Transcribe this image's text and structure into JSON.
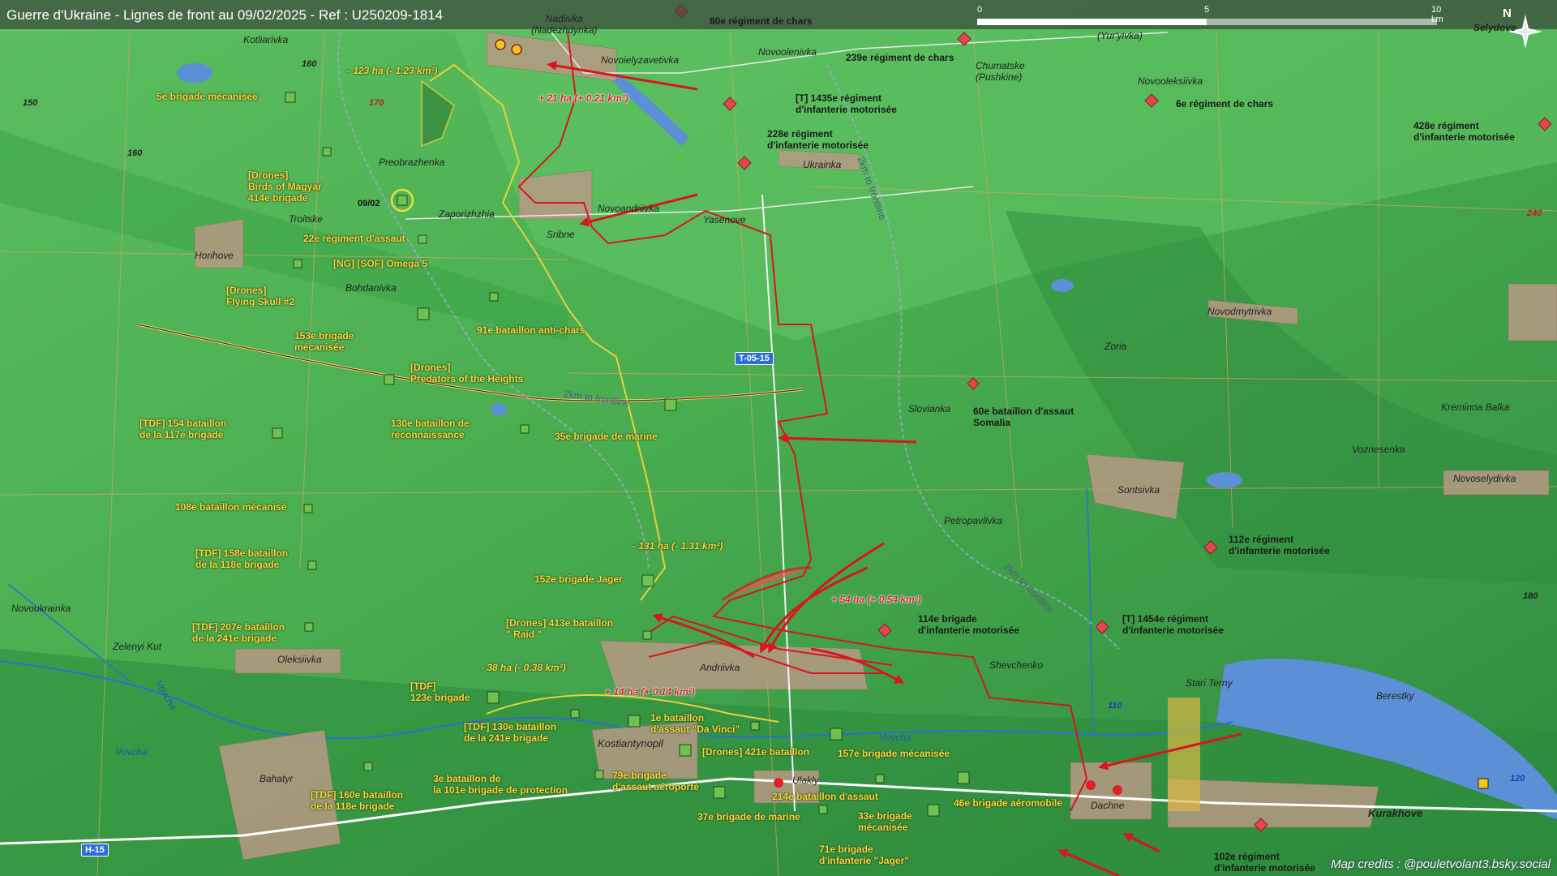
{
  "title": "Guerre d'Ukraine - Lignes de front au 09/02/2025 - Ref : U250209-1814",
  "credits": "Map credits : @pouletvolant3.bsky.social",
  "scale": {
    "ticks": [
      "0",
      "5",
      "10 km"
    ]
  },
  "north": "N",
  "colors": {
    "front": "#d8161e",
    "ua_unit": "#ffd23a",
    "ru_unit": "#e4464f",
    "water": "#5b8fd6"
  },
  "towns": {
    "nadiivka": "Nadiivka\n(Nadezhdynka)",
    "kotliarivka": "Kotliarivka",
    "novoielyzavetivka": "Novoielyzavetivka",
    "novoolenivka": "Novoolenivka",
    "chumatske": "Chumatske\n(Pushkine)",
    "yuryivka": "(Yur'yivka)",
    "selydove": "Selydove",
    "novooleksiivka": "Novooleksiivka",
    "preobrazhenka": "Preobrazhenka",
    "ukrainka": "Ukrainka",
    "troitske": "Troitske",
    "zaporizhzhia": "Zaporizhzhia",
    "novoandriivka": "Novoandriivka",
    "yasenove": "Yasenove",
    "sribne": "Sribne",
    "horihove": "Horihove",
    "bohdanivka": "Bohdanivka",
    "novodmytrivka": "Novodmytrivka",
    "zoria": "Zoria",
    "slovianka": "Slovianka",
    "kreminna_balka": "Kreminna Balka",
    "voznesenka": "Voznesenka",
    "novoselydivka": "Novoselydivka",
    "sontsivka": "Sontsivka",
    "petropavlivka": "Petropavlivka",
    "novoukrainka": "Novoukrainka",
    "zelenyi_kut": "Zelenyi Kut",
    "oleksiivka": "Oleksiivka",
    "andriivka": "Andriivka",
    "shevchenko": "Shevchenko",
    "stari_terny": "Stari Terny",
    "berestky": "Berestky",
    "kostiantynopil": "Kostiantynopil",
    "ulakly": "Ulakly",
    "bahatyr": "Bahatyr",
    "dachne": "Dachne",
    "kurakhove": "Kurakhove"
  },
  "rivers": {
    "vovcha1": "Vovcha",
    "vovcha2": "Vovcha",
    "vovcha3": "Vovcha"
  },
  "contours": {
    "c150": "150",
    "c160a": "160",
    "c160b": "160",
    "c170": "170",
    "c180": "180",
    "c240": "240",
    "c110": "110",
    "c120": "120"
  },
  "roads": {
    "t0515": "T-05-15",
    "h15": "H-15"
  },
  "frontline_notes": {
    "n1": "2km to frontline",
    "n2": "2km to frontline",
    "n3": "2km to frontline"
  },
  "date_marker": "09/02",
  "area_changes": {
    "loss_north": "- 123 ha (- 1.23 km²)",
    "gain_north": "+ 21 ha (+ 0.21 km²)",
    "loss_center": "- 131 ha (- 1.31 km²)",
    "gain_center": "+ 54 ha (+ 0.54 km²)",
    "loss_south": "- 38 ha (- 0.38 km²)",
    "gain_south": "+ 14 ha (+ 0.14 km²)"
  },
  "ru_units": {
    "r80": "80e régiment de chars",
    "r239": "239e régiment de chars",
    "r1435": "[T] 1435e régiment\nd'infanterie motorisée",
    "r228": "228e régiment\nd'infanterie motorisée",
    "r6": "6e régiment de chars",
    "r428": "428e régiment\nd'infanterie motorisée",
    "r60": "60e bataillon d'assaut\nSomalia",
    "r112": "112e régiment\nd'infanterie motorisée",
    "r114": "114e brigade\nd'infanterie motorisée",
    "r1454": "[T] 1454e régiment\nd'infanterie motorisée",
    "r102": "102e régiment\nd'infanterie motorisée"
  },
  "ua_units": {
    "u5": "5e brigade mécanisée",
    "u414": "[Drones]\nBirds of Magyar\n414e brigade",
    "u22": "22e régiment d'assaut",
    "uomega": "[NG] [SOF] Omega 5",
    "uskull": "[Drones]\nFlying Skull #2",
    "u153": "153e brigade\nmécanisée",
    "u91": "91e bataillon anti-chars",
    "upred": "[Drones]\nPredators of the Heights",
    "u154": "[TDF] 154 bataillon\nde la 117e brigade",
    "u130r": "130e bataillon de\nreconnaissance",
    "u35": "35e brigade de marine",
    "u108": "108e bataillon mécanisé",
    "u158": "[TDF] 158e bataillon\nde la 118e brigade",
    "u152": "152e brigade Jager",
    "u207": "[TDF] 207e bataillon\nde la 241e brigade",
    "u413": "[Drones] 413e bataillon\n\" Raid \"",
    "u123": "[TDF]\n123e brigade",
    "u130t": "[TDF] 130e bataillon\nde la 241e brigade",
    "u1dv": "1e bataillon\nd'assaut \"Da Vinci\"",
    "u421": "[Drones] 421e bataillon",
    "u157": "157e brigade mécanisée",
    "u3": "3e bataillon de\nla 101e brigade de protection",
    "u79": "79e brigade\nd'assaut aéroporté",
    "u214": "214e bataillon d'assaut",
    "u46": "46e brigade aéromobile",
    "u160": "[TDF] 160e bataillon\nde la 118e brigade",
    "u37": "37e brigade de marine",
    "u33": "33e brigade\nmécanisée",
    "u71": "71e brigade\nd'infanterie \"Jager\""
  }
}
